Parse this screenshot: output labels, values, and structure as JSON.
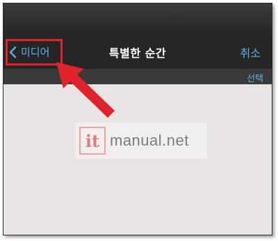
{
  "navbar": {
    "back_label": "미디어",
    "title": "특별한 순간",
    "cancel_label": "취소"
  },
  "subbar": {
    "select_label": "선택"
  },
  "watermark": {
    "logo_text": "it",
    "site": "manual.net"
  },
  "annotation": {
    "highlight_color": "#e0232a"
  },
  "colors": {
    "link": "#5fb0e6",
    "navbar_bg": "#262626",
    "content_bg": "#e8e5e4"
  }
}
